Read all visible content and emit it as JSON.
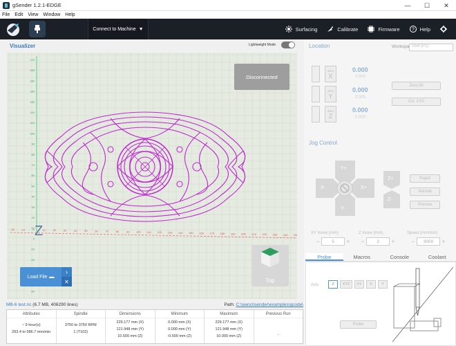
{
  "window": {
    "title": "gSender 1.2.1-EDGE",
    "controls": [
      "—",
      "☐",
      "✕"
    ]
  },
  "menu": [
    "File",
    "Edit",
    "View",
    "Window",
    "Help"
  ],
  "header": {
    "connect_label": "Connect to Machine",
    "nav": [
      {
        "label": "Surfacing",
        "icon": "surfacing-icon"
      },
      {
        "label": "Calibrate",
        "icon": "calibrate-icon"
      },
      {
        "label": "Firmware",
        "icon": "firmware-icon"
      },
      {
        "label": "Help",
        "icon": "help-icon"
      },
      {
        "label": "Settings",
        "icon": "gear-icon"
      }
    ]
  },
  "visualizer": {
    "title": "Visualizer",
    "lightweight_label": "Lightweight Mode",
    "status": "Disconnected",
    "load_file_label": "Load File",
    "view_label": "Top",
    "axis_y_ticks": [
      "170",
      "160",
      "150",
      "140",
      "130",
      "120",
      "110",
      "100",
      "90",
      "80",
      "70",
      "60",
      "50",
      "40",
      "30",
      "20",
      "10",
      "0",
      "-10",
      "-20",
      "-30",
      "-40",
      "-50"
    ],
    "axis_x_ticks": [
      "-20",
      "-10",
      "0",
      "10",
      "20",
      "30",
      "40",
      "50",
      "60",
      "70",
      "80",
      "90",
      "100",
      "110",
      "120",
      "130",
      "140",
      "150",
      "160",
      "170",
      "180",
      "190",
      "200",
      "210",
      "220",
      "230",
      "240",
      "250"
    ],
    "axis_z_label": "Z"
  },
  "file": {
    "name": "MB-6 test.nc",
    "stats": "(6.7 MB, 406290 lines)",
    "path_label": "Path:",
    "path": "C:\\sienci\\sender\\examples\\gcode\\"
  },
  "stats": [
    {
      "header": "Attributes",
      "values": [
        "~ 9 hour(s)",
        "293.4 to 586.7 mm/min"
      ]
    },
    {
      "header": "Spindle",
      "values": [
        "3750 to 3750 RPM",
        "1 (T102)"
      ]
    },
    {
      "header": "Dimensions",
      "values": [
        "229.177 mm (X)",
        "121.948 mm (Y)",
        "10.500 mm (Z)"
      ]
    },
    {
      "header": "Minimum",
      "values": [
        "0.000 mm (X)",
        "0.000 mm (Y)",
        "-0.500 mm (Z)"
      ]
    },
    {
      "header": "Maximum",
      "values": [
        "229.177 mm (X)",
        "121.948 mm (Y)",
        "10.000 mm (Z)"
      ]
    },
    {
      "header": "Previous Run",
      "values": [
        "-"
      ]
    }
  ],
  "location": {
    "title": "Location",
    "workspace_label": "Workspace:",
    "workspace_value": "G54 (P1)",
    "axes": [
      {
        "axis": "X",
        "value": "0.000",
        "sub": "0.000"
      },
      {
        "axis": "Y",
        "value": "0.000",
        "sub": "0.000"
      },
      {
        "axis": "Z",
        "value": "0.000",
        "sub": "0.000"
      }
    ],
    "zero_label": "Zero",
    "zero_all_label": "Zero All",
    "go_xy0_label": "Go: XY0"
  },
  "jog": {
    "title": "Jog Control",
    "dirs": {
      "yplus": "Y+",
      "yminus": "Y-",
      "xplus": "X+",
      "xminus": "X-",
      "zplus": "Z+",
      "zminus": "Z-"
    },
    "speeds": [
      "Rapid",
      "Normal",
      "Precise"
    ],
    "xy_label": "XY move (mm)",
    "xy_value": "5",
    "z_label": "Z move (mm)",
    "z_value": "2",
    "speed_label": "Speed (mm/min)",
    "speed_value": "3000"
  },
  "tabs": [
    "Probe",
    "Macros",
    "Console",
    "Coolant"
  ],
  "probe": {
    "axis_label": "Axis",
    "options": [
      "Z",
      "XYZ",
      "XY",
      "X",
      "Y"
    ],
    "button_label": "Probe"
  },
  "colors": {
    "header": "#1b1f26",
    "accent": "#4a90d4",
    "toolpath": "#c026d3",
    "canvas": "#e6ebe1"
  }
}
